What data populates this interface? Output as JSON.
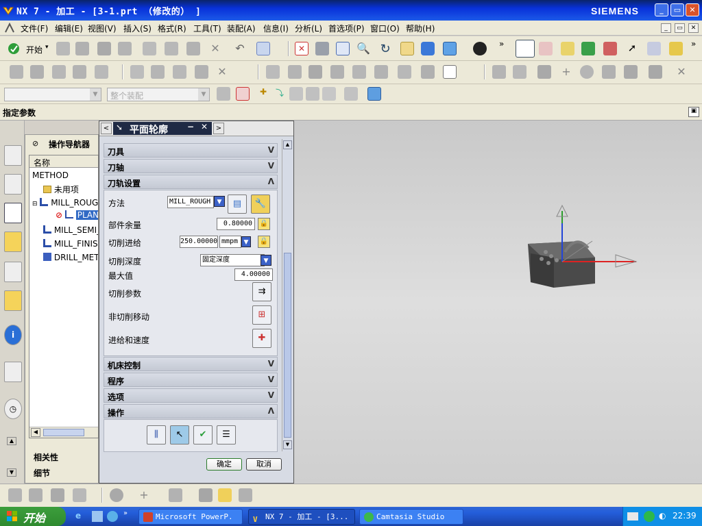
{
  "app": {
    "title": "NX 7 - 加工 - [3-1.prt （修改的） ]",
    "brand": "SIEMENS"
  },
  "menu": [
    "文件(F)",
    "编辑(E)",
    "视图(V)",
    "插入(S)",
    "格式(R)",
    "工具(T)",
    "装配(A)",
    "信息(I)",
    "分析(L)",
    "首选项(P)",
    "窗口(O)",
    "帮助(H)"
  ],
  "toolbar": {
    "start_label": "开始",
    "filter_placeholder": "",
    "assembly_label": "整个装配"
  },
  "prompt": "指定参数",
  "navigator": {
    "title": "操作导航器",
    "column_header": "名称",
    "root": "METHOD",
    "items": [
      {
        "label": "未用项"
      },
      {
        "label": "MILL_ROUGH"
      },
      {
        "label": "PLANAR_PROFILE"
      },
      {
        "label": "MILL_SEMI_FINISH"
      },
      {
        "label": "MILL_FINISH"
      },
      {
        "label": "DRILL_METHOD"
      }
    ],
    "bottom_sections": [
      "相关性",
      "细节"
    ]
  },
  "dialog": {
    "title": "平面轮廓",
    "sections_collapsed_top": [
      "刀具",
      "刀轴"
    ],
    "settings_title": "刀轨设置",
    "fields": {
      "method_label": "方法",
      "method_value": "MILL_ROUGH",
      "stock_label": "部件余量",
      "stock_value": "0.80000",
      "feed_label": "切削进给",
      "feed_value": "250.00000",
      "feed_unit": "mmpm",
      "depth_label": "切削深度",
      "depth_value": "固定深度",
      "max_label": "最大值",
      "max_value": "4.00000",
      "cut_params_label": "切削参数",
      "noncut_label": "非切削移动",
      "feeds_label": "进给和速度"
    },
    "sections_collapsed_bottom": [
      "机床控制",
      "程序",
      "选项"
    ],
    "actions_title": "操作",
    "ok_label": "确定",
    "cancel_label": "取消"
  },
  "taskbar": {
    "start_label": "开始",
    "tasks": [
      "Microsoft PowerP.",
      "NX 7 - 加工 - [3...",
      "Camtasia Studio"
    ],
    "time": "22:39"
  },
  "colors": {
    "title_blue": "#0831d9",
    "accent_red": "#e23a2a",
    "section_grey": "#c4c9d4",
    "taskbar_blue": "#245edb"
  }
}
